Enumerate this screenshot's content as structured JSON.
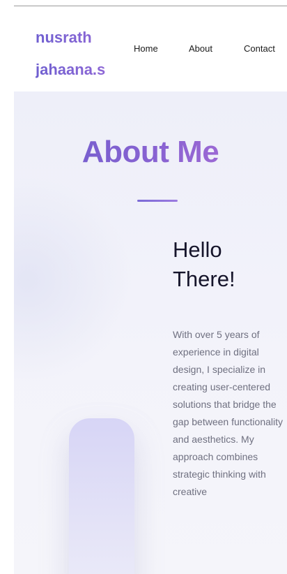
{
  "header": {
    "brand_line1": "nusrath",
    "brand_line2": "jahaana.s",
    "nav": {
      "home": "Home",
      "about": "About",
      "contact": "Contact"
    }
  },
  "about": {
    "title": "About Me",
    "hello": "Hello There!",
    "paragraph": "With over 5 years of experience in digital design, I specialize in creating user-centered solutions that bridge the gap between functionality and aesthetics. My approach combines strategic thinking with creative"
  },
  "colors": {
    "accent_start": "#6b5ccc",
    "accent_end": "#b06fd6",
    "heading": "#16152b",
    "body_text": "#6f7080",
    "section_bg": "#eeeff9"
  }
}
